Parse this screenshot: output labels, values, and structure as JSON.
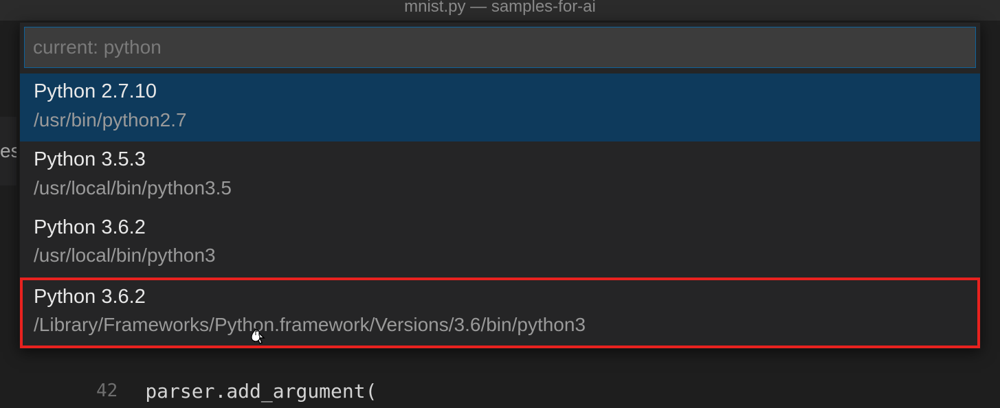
{
  "title_bar": "mnist.py — samples-for-ai",
  "side_panel_text": "es",
  "quick_pick": {
    "placeholder": "current: python",
    "options": [
      {
        "title": "Python 2.7.10",
        "path": "/usr/bin/python2.7",
        "selected": true,
        "highlighted": false
      },
      {
        "title": "Python 3.5.3",
        "path": "/usr/local/bin/python3.5",
        "selected": false,
        "highlighted": false
      },
      {
        "title": "Python 3.6.2",
        "path": "/usr/local/bin/python3",
        "selected": false,
        "highlighted": false
      },
      {
        "title": "Python 3.6.2",
        "path": "/Library/Frameworks/Python.framework/Versions/3.6/bin/python3",
        "selected": false,
        "highlighted": true
      }
    ]
  },
  "editor": {
    "line_number": "42",
    "code": "parser.add_argument("
  }
}
